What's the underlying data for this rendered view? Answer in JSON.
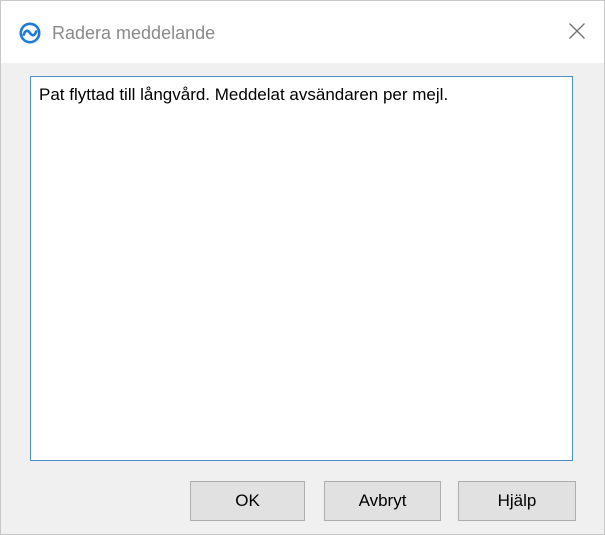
{
  "window": {
    "title": "Radera meddelande",
    "icon": "sync-circle-icon",
    "close_icon": "close-icon"
  },
  "message": {
    "value": "Pat flyttad till långvård. Meddelat avsändaren per mejl."
  },
  "buttons": {
    "ok_label": "OK",
    "cancel_label": "Avbryt",
    "help_label": "Hjälp"
  },
  "colors": {
    "accent": "#1e7ad2",
    "focus_border": "#4e8ec9",
    "dialog_background": "#f0f0f0",
    "button_face": "#e1e1e1"
  }
}
